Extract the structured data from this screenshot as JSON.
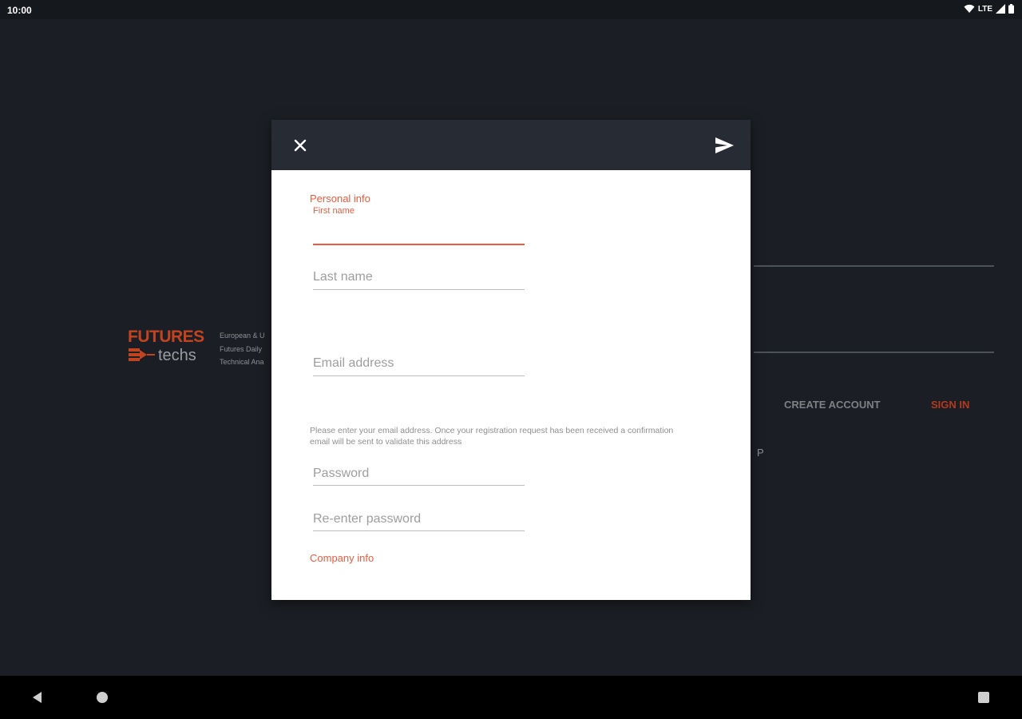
{
  "status_bar": {
    "time": "10:00",
    "network": "LTE",
    "icons": [
      "wifi-icon",
      "cell-signal-icon",
      "battery-icon"
    ]
  },
  "background": {
    "logo": {
      "word1": "FUTURES",
      "word2": "techs"
    },
    "tagline_lines": [
      "European & U",
      "Futures Daily",
      "Technical Ana"
    ],
    "create_account": "CREATE ACCOUNT",
    "sign_in": "SIGN IN",
    "fragment": "P"
  },
  "dialog": {
    "close_icon": "close-icon",
    "send_icon": "send-icon",
    "personal_info_title": "Personal info",
    "first_name": {
      "label": "First name",
      "value": ""
    },
    "last_name": {
      "placeholder": "Last name"
    },
    "email": {
      "placeholder": "Email address"
    },
    "helper_text": "Please enter your email address. Once your registration request has been received a confirmation email will be sent to validate this address",
    "password": {
      "placeholder": "Password"
    },
    "reenter_password": {
      "placeholder": "Re-enter password"
    },
    "company_info_title": "Company info"
  },
  "nav_bar": {
    "icons": [
      "back-icon",
      "home-icon",
      "recents-icon"
    ]
  },
  "colors": {
    "accent": "#ef5a3f",
    "logo_accent": "#c1441f",
    "background": "#1b1e24",
    "dialog_header": "#272b34"
  }
}
